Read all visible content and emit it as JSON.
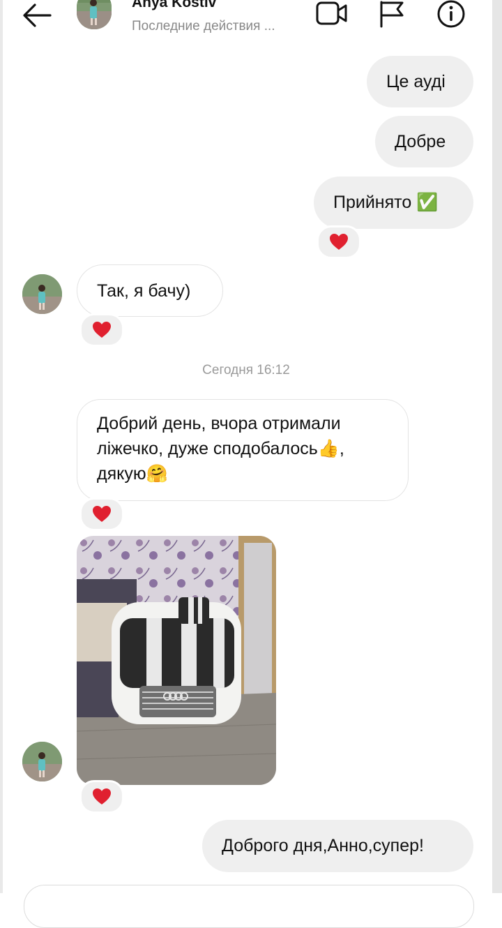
{
  "header": {
    "name": "Anya Kostiv",
    "status": "Последние действия ..."
  },
  "messages": {
    "out1": "Це ауді",
    "out2": "Добре",
    "out3": "Прийнято ✅",
    "in1": "Так, я бачу)",
    "timestamp": "Сегодня 16:12",
    "in2_line1": "Добрий день, вчора отримали",
    "in2_line2": "ліжечко, дуже сподобалось👍,",
    "in2_line3": "дякую🤗",
    "out4": "Доброго дня,Анно,супер!"
  },
  "icons": {
    "back": "back-arrow-icon",
    "video": "video-camera-icon",
    "flag": "flag-icon",
    "info": "info-icon",
    "reaction": "heart-icon"
  },
  "colors": {
    "outgoing_bubble": "#efefef",
    "heart": "#e0202f",
    "muted_text": "#888888"
  }
}
